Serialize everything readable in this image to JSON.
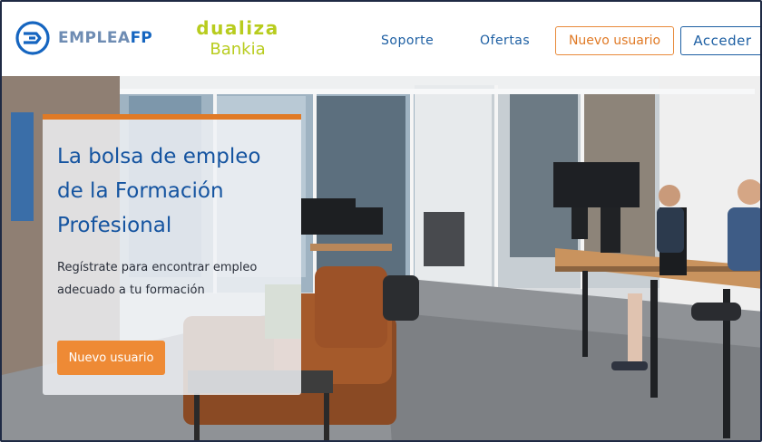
{
  "brand": {
    "logo_text_main": "EMPLEA",
    "logo_text_accent": "FP",
    "logo_icon": "emplea-fp-logo-icon",
    "partner_top": "dualiza",
    "partner_bottom": "Bankia"
  },
  "nav": {
    "links": [
      {
        "label": "Soporte"
      },
      {
        "label": "Ofertas"
      }
    ],
    "signup_button": "Nuevo usuario",
    "login_button": "Acceder"
  },
  "hero": {
    "title_lines": [
      "La bolsa de empleo",
      "de la Formación",
      "Profesional"
    ],
    "subtitle_lines": [
      "Regístrate para encontrar empleo",
      "adecuado a tu formación"
    ],
    "cta_button": "Nuevo usuario"
  },
  "colors": {
    "brand_blue": "#1554a0",
    "accent_orange": "#e07a26",
    "partner_green": "#b8cc1e"
  }
}
